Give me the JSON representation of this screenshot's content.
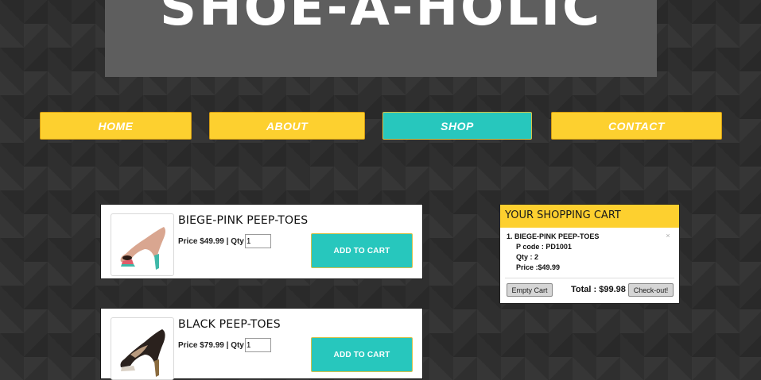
{
  "site": {
    "title": "SHOE-A-HOLIC"
  },
  "nav": [
    {
      "label": "HOME",
      "active": false
    },
    {
      "label": "ABOUT",
      "active": false
    },
    {
      "label": "SHOP",
      "active": true
    },
    {
      "label": "CONTACT",
      "active": false
    }
  ],
  "products": [
    {
      "name": "BIEGE-PINK PEEP-TOES",
      "price_text": "Price $49.99",
      "qty_label": "Qty",
      "qty_value": "1",
      "button_label": "ADD TO CART",
      "image_icon": "beige-pink-peep-toe-shoe"
    },
    {
      "name": "BLACK PEEP-TOES",
      "price_text": "Price $79.99",
      "qty_label": "Qty",
      "qty_value": "1",
      "button_label": "ADD TO CART",
      "image_icon": "black-peep-toe-shoe"
    }
  ],
  "cart": {
    "title": "YOUR SHOPPING CART",
    "items": [
      {
        "index": "1.",
        "name": "BIEGE-PINK PEEP-TOES",
        "pcode": "P code : PD1001",
        "qty": "Qty : 2",
        "price": "Price :$49.99"
      }
    ],
    "remove_icon": "×",
    "empty_label": "Empty Cart",
    "total_text": "Total : $99.98",
    "checkout_label": "Check-out!"
  },
  "colors": {
    "accent_yellow": "#fdd02f",
    "accent_teal": "#27c7bd",
    "background": "#2f2f2f"
  }
}
